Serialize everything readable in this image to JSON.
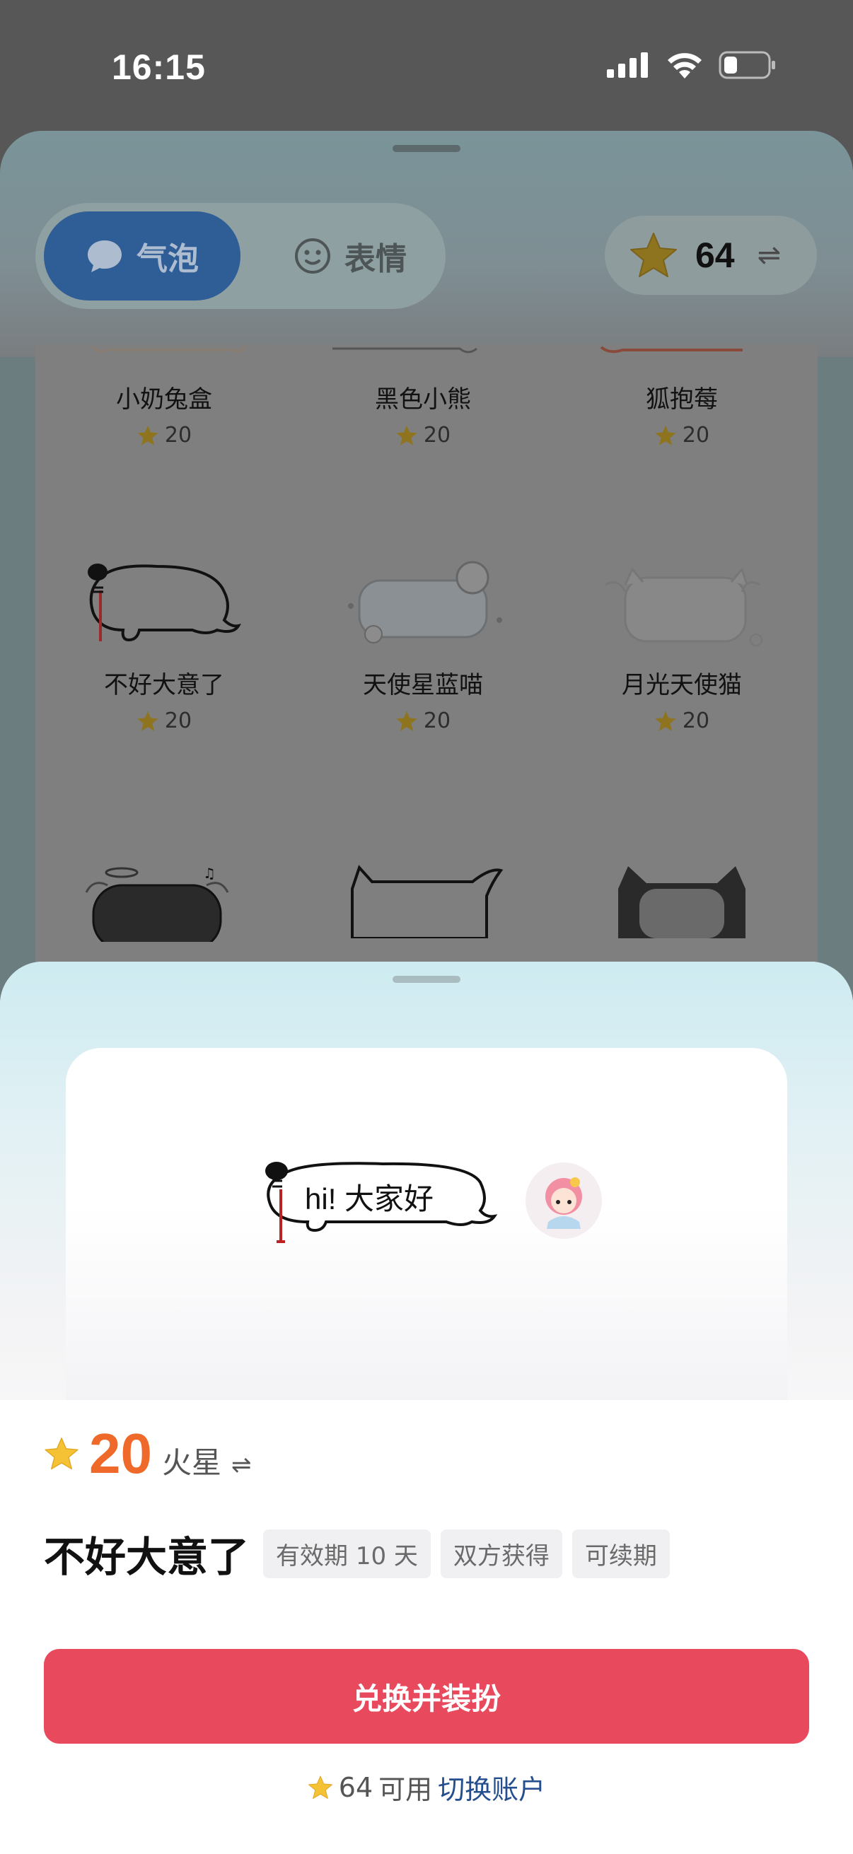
{
  "status": {
    "time": "16:15"
  },
  "tabs": [
    {
      "label": "气泡",
      "icon": "chat-bubble-icon",
      "active": true
    },
    {
      "label": "表情",
      "icon": "smiley-icon",
      "active": false
    }
  ],
  "balance": {
    "value": "64",
    "icon": "star-icon",
    "swap": "⇌"
  },
  "grid": {
    "items": [
      {
        "name": "小奶兔盒",
        "price": "20"
      },
      {
        "name": "黑色小熊",
        "price": "20"
      },
      {
        "name": "狐抱莓",
        "price": "20"
      },
      {
        "name": "不好大意了",
        "price": "20"
      },
      {
        "name": "天使星蓝喵",
        "price": "20"
      },
      {
        "name": "月光天使猫",
        "price": "20"
      }
    ]
  },
  "preview": {
    "bubble_text": "hi! 大家好"
  },
  "detail": {
    "price": "20",
    "currency": "火星",
    "swap": "⇌",
    "title": "不好大意了",
    "tags": [
      "有效期 10 天",
      "双方获得",
      "可续期"
    ],
    "cta": "兑换并装扮",
    "available_count": "64",
    "available_label": "可用",
    "switch_account": "切换账户"
  },
  "colors": {
    "cta": "#e8495c",
    "price": "#ef6a2a",
    "link": "#254e8f",
    "star": "#f5c236"
  }
}
